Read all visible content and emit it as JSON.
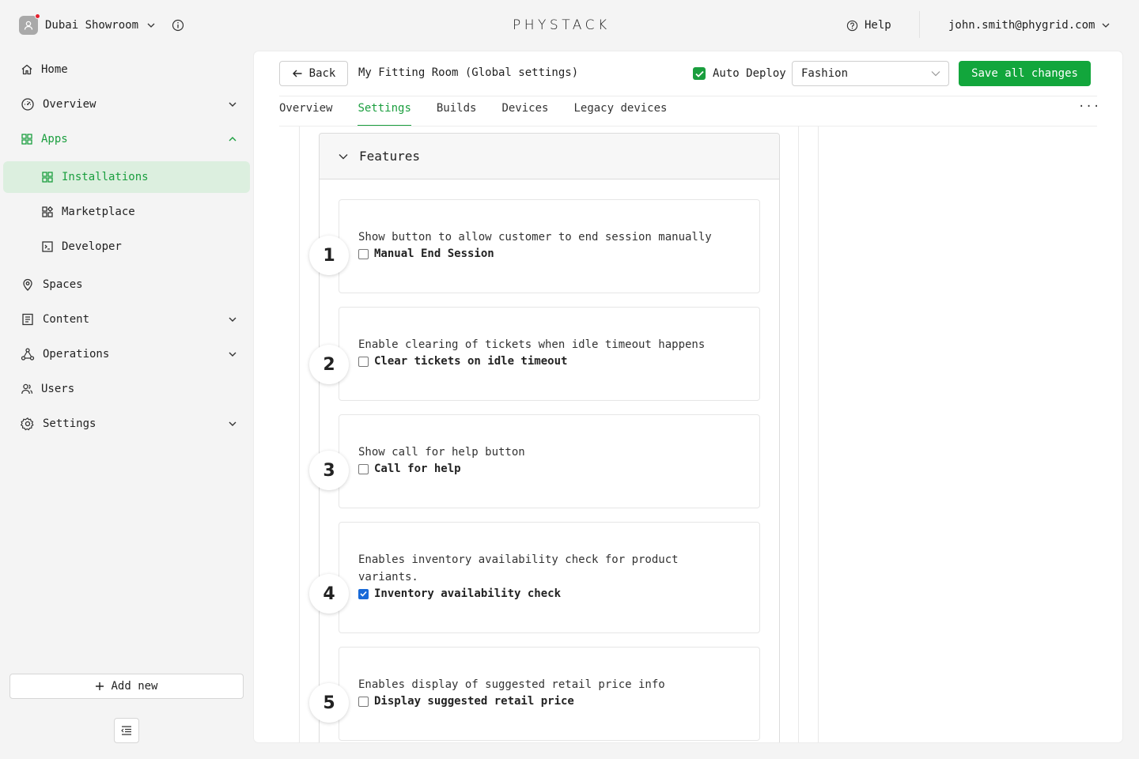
{
  "topbar": {
    "workspace_name": "Dubai Showroom",
    "logo": "PHYSTACK",
    "help_label": "Help",
    "user_email": "john.smith@phygrid.com"
  },
  "sidebar": {
    "items": [
      {
        "label": "Home",
        "icon": "home-icon"
      },
      {
        "label": "Overview",
        "icon": "dashboard-icon"
      },
      {
        "label": "Apps",
        "icon": "apps-icon"
      },
      {
        "label": "Spaces",
        "icon": "location-pin-icon"
      },
      {
        "label": "Content",
        "icon": "content-icon"
      },
      {
        "label": "Operations",
        "icon": "operations-icon"
      },
      {
        "label": "Users",
        "icon": "users-icon"
      },
      {
        "label": "Settings",
        "icon": "gear-icon"
      }
    ],
    "sub_items": [
      {
        "label": "Installations",
        "icon": "grid-icon"
      },
      {
        "label": "Marketplace",
        "icon": "marketplace-icon"
      },
      {
        "label": "Developer",
        "icon": "terminal-icon"
      }
    ],
    "add_new_label": "Add new"
  },
  "header": {
    "back_label": "Back",
    "title": "My Fitting Room (Global settings)",
    "auto_deploy_label": "Auto Deploy",
    "auto_deploy_checked": true,
    "select_value": "Fashion",
    "save_label": "Save all changes"
  },
  "tabs": [
    {
      "label": "Overview"
    },
    {
      "label": "Settings"
    },
    {
      "label": "Builds"
    },
    {
      "label": "Devices"
    },
    {
      "label": "Legacy devices"
    }
  ],
  "more_label": "···",
  "features": {
    "title": "Features",
    "cards": [
      {
        "step": "1",
        "description": "Show button to allow customer to end session manually",
        "label": "Manual End Session",
        "checked": false
      },
      {
        "step": "2",
        "description": "Enable clearing of tickets when idle timeout happens",
        "label": "Clear tickets on idle timeout",
        "checked": false
      },
      {
        "step": "3",
        "description": "Show call for help button",
        "label": "Call for help",
        "checked": false
      },
      {
        "step": "4",
        "description": "Enables inventory availability check for product variants.",
        "label": "Inventory availability check",
        "checked": true
      },
      {
        "step": "5",
        "description": "Enables display of suggested retail price info",
        "label": "Display suggested retail price",
        "checked": false
      }
    ]
  },
  "colors": {
    "accent": "#1a9e3e",
    "save_button": "#12a63c",
    "active_nav_bg": "#dcefdf",
    "checkbox_checked": "#1769d8"
  }
}
